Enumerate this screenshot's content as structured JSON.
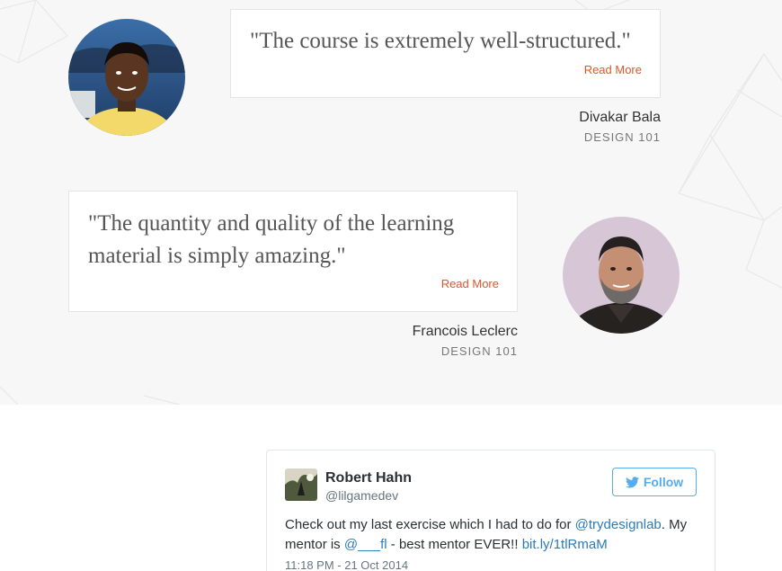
{
  "testimonials": [
    {
      "quote": "\"The course is extremely well-structured.\"",
      "read_more": "Read More",
      "name": "Divakar Bala",
      "course": "DESIGN 101"
    },
    {
      "quote": "\"The quantity and quality of the learning material is simply amazing.\"",
      "read_more": "Read More",
      "name": "Francois Leclerc",
      "course": "DESIGN 101"
    }
  ],
  "tweet": {
    "author_name": "Robert Hahn",
    "author_handle": "@lilgamedev",
    "follow_label": "Follow",
    "text_1": "Check out my last exercise which I had to do for ",
    "mention_1": "@trydesignlab",
    "text_2": ". My mentor is ",
    "mention_2": "@___fl",
    "text_3": " - best mentor EVER!! ",
    "link": "bit.ly/1tlRmaM",
    "timestamp": "11:18 PM - 21 Oct 2014"
  },
  "colors": {
    "accent": "#e2542b",
    "twitter_blue": "#55acee",
    "link_blue": "#2b7bb9",
    "section_bg": "#f7f7f7"
  },
  "icons": [
    "twitter-bird-icon"
  ]
}
